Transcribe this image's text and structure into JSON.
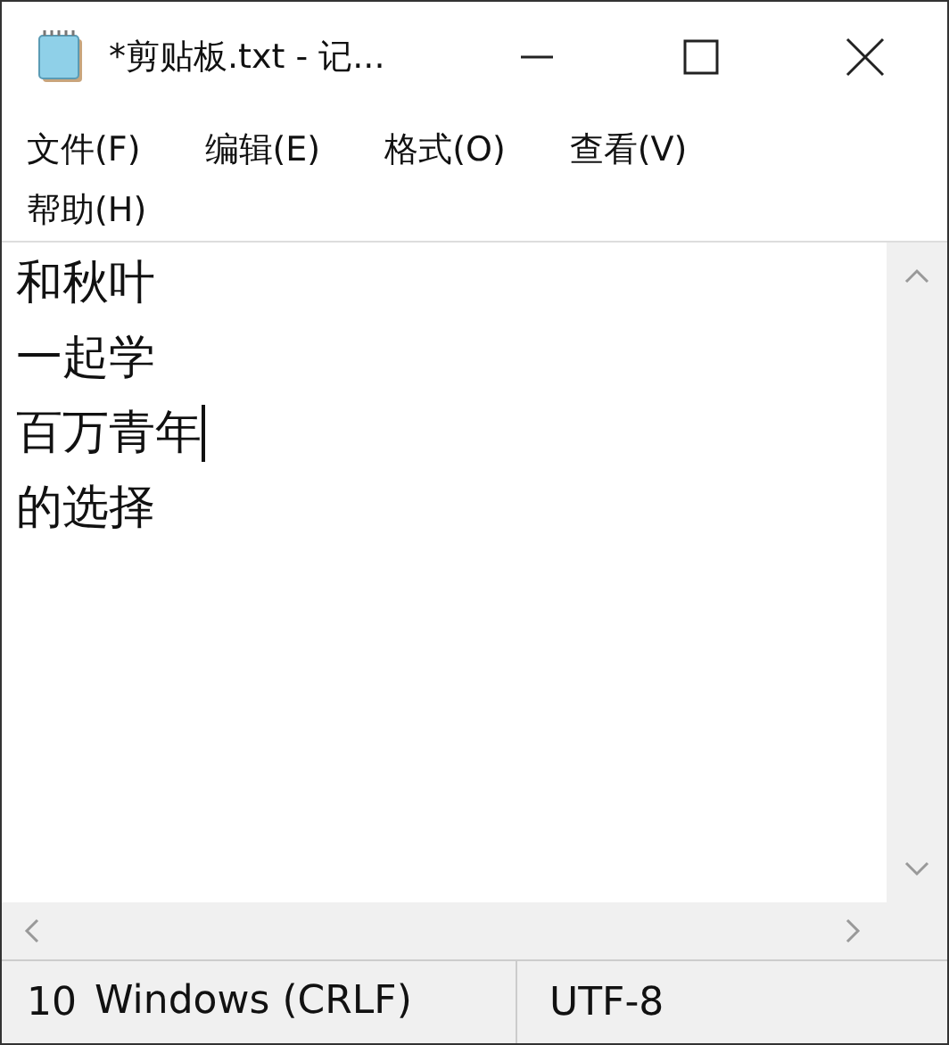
{
  "window": {
    "title": "*剪贴板.txt - 记..."
  },
  "menu": [
    "文件(F)",
    "编辑(E)",
    "格式(O)",
    "查看(V)",
    "帮助(H)"
  ],
  "lines": [
    {
      "text": "和秋叶",
      "caret": false
    },
    {
      "text": "一起学",
      "caret": false
    },
    {
      "text": "百万青年",
      "caret": true
    },
    {
      "text": "的选择",
      "caret": false
    }
  ],
  "status_bar": [
    "10",
    "Windows (CRLF)",
    "UTF-8"
  ]
}
